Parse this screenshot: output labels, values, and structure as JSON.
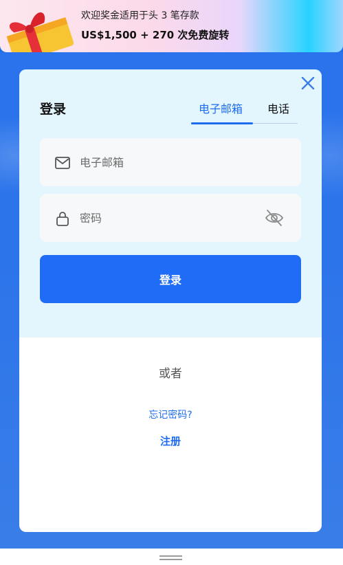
{
  "promo": {
    "line1": "欢迎奖金适用于头 3 笔存款",
    "line2": "US$1,500 + 270 次免费旋转"
  },
  "modal": {
    "title": "登录",
    "tabs": [
      {
        "label": "电子邮箱",
        "active": true
      },
      {
        "label": "电话",
        "active": false
      }
    ],
    "email_placeholder": "电子邮箱",
    "password_placeholder": "密码",
    "login_label": "登录",
    "or_text": "或者",
    "forgot_label": "忘记密码?",
    "register_label": "注册"
  },
  "colors": {
    "accent": "#1e6cf0",
    "button": "#1f6cf6",
    "modal_top_bg": "#e3f5fd",
    "page_bg": "#1f6fe8"
  },
  "icons": [
    "gift-icon",
    "close-icon",
    "mail-icon",
    "lock-icon",
    "eye-off-icon",
    "drag-handle-icon"
  ]
}
